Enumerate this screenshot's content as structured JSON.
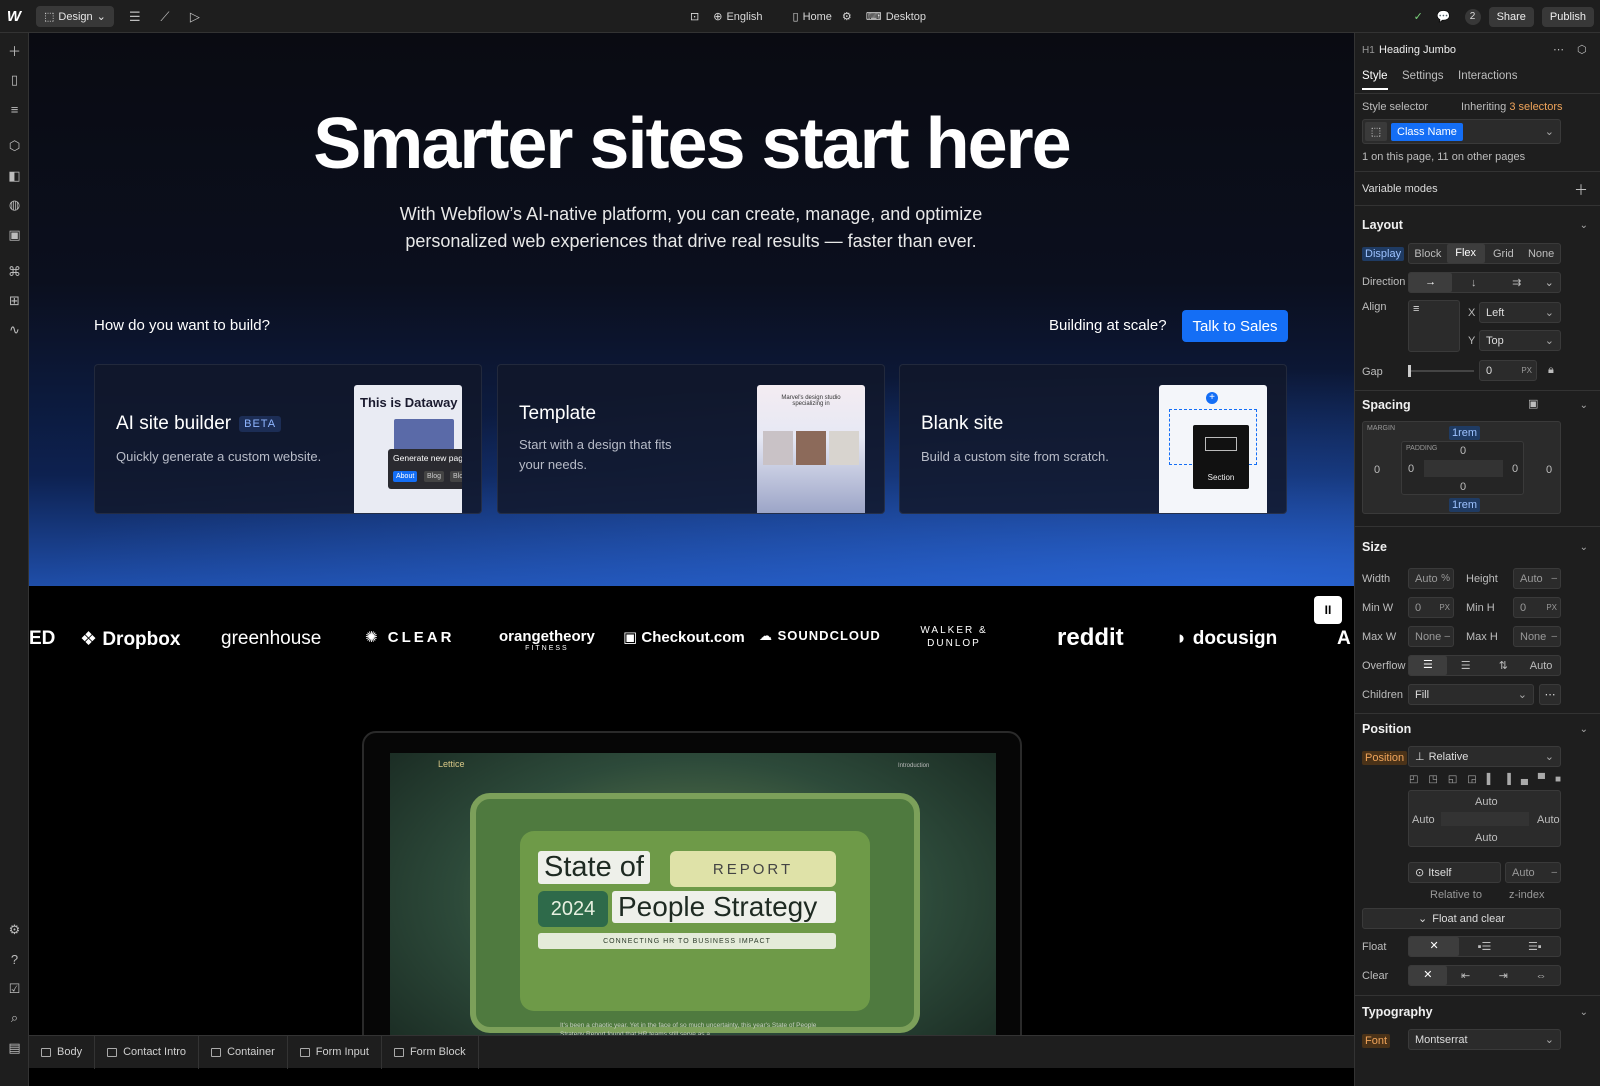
{
  "topbar": {
    "mode": "Design",
    "language": "English",
    "page": "Home",
    "breakpoint": "Desktop",
    "collab_count": "2",
    "share": "Share",
    "publish": "Publish"
  },
  "hero": {
    "title": "Smarter sites start here",
    "subtitle_line1": "With Webflow’s AI-native platform, you can create, manage, and optimize",
    "subtitle_line2": "personalized web experiences that drive real results — faster than ever.",
    "build_question": "How do you want to build?",
    "scale_question": "Building at scale?",
    "cta": "Talk to Sales"
  },
  "cards": [
    {
      "title": "AI site builder",
      "badge": "BETA",
      "desc": "Quickly generate a custom website.",
      "thumb_title": "This is Dataway",
      "thumb_popup": "Generate new page",
      "thumb_chips": [
        "About",
        "Blog",
        "Blog Post"
      ]
    },
    {
      "title": "Template",
      "desc_line1": "Start with a design that fits",
      "desc_line2": "your needs.",
      "thumb_title": "Marvel's design studio specializing in"
    },
    {
      "title": "Blank site",
      "desc": "Build a custom site from scratch.",
      "thumb_label": "Section"
    }
  ],
  "logos": [
    "ED",
    "Dropbox",
    "greenhouse",
    "CLEAR",
    "orangetheory",
    "Checkout.com",
    "SOUNDCLOUD",
    "WALKER & DUNLOP",
    "reddit",
    "docusign",
    "A"
  ],
  "logos_sub": {
    "orangetheory": "FITNESS"
  },
  "device": {
    "brand": "Lettice",
    "nav": "Introduction",
    "report_l1": "State of",
    "report_badge": "REPORT",
    "report_year": "2024",
    "report_l2": "People Strategy",
    "report_tag": "CONNECTING HR TO BUSINESS IMPACT",
    "caption": "It's been a chaotic year. Yet in the face of so much uncertainty, this year's State of People Strategy Report found that HR teams still serve as a"
  },
  "breadcrumbs": [
    "Body",
    "Contact Intro",
    "Container",
    "Form Input",
    "Form Block"
  ],
  "panel": {
    "element_tag": "H1",
    "element_name": "Heading Jumbo",
    "tabs": [
      "Style",
      "Settings",
      "Interactions"
    ],
    "selector_label": "Style selector",
    "inheriting": "Inheriting",
    "inheriting_count": "3 selectors",
    "class_name": "Class Name",
    "usage": "1 on this page, 11 on other pages",
    "variable_modes": "Variable modes",
    "layout": {
      "title": "Layout",
      "display_label": "Display",
      "display_opts": [
        "Block",
        "Flex",
        "Grid",
        "None"
      ],
      "direction_label": "Direction",
      "align_label": "Align",
      "x_label": "X",
      "x_val": "Left",
      "y_label": "Y",
      "y_val": "Top",
      "gap_label": "Gap",
      "gap_val": "0",
      "gap_unit": "PX"
    },
    "spacing": {
      "title": "Spacing",
      "margin_label": "MARGIN",
      "padding_label": "PADDING",
      "margin_top": "1rem",
      "margin_bottom": "1rem",
      "margin_left": "0",
      "margin_right": "0",
      "pad_top": "0",
      "pad_bottom": "0",
      "pad_left": "0",
      "pad_right": "0"
    },
    "size": {
      "title": "Size",
      "width_label": "Width",
      "width_val": "Auto",
      "width_unit": "%",
      "height_label": "Height",
      "height_val": "Auto",
      "height_unit": "–",
      "minw_label": "Min W",
      "minw_val": "0",
      "minw_unit": "PX",
      "minh_label": "Min H",
      "minh_val": "0",
      "minh_unit": "PX",
      "maxw_label": "Max W",
      "maxw_val": "None",
      "maxh_label": "Max H",
      "maxh_val": "None",
      "dash": "–",
      "overflow_label": "Overflow",
      "overflow_auto": "Auto",
      "children_label": "Children",
      "children_val": "Fill"
    },
    "position": {
      "title": "Position",
      "label": "Position",
      "val": "Relative",
      "top": "Auto",
      "left": "Auto",
      "right": "Auto",
      "bottom": "Auto",
      "rel_val": "Itself",
      "z_val": "Auto",
      "rel_label": "Relative to",
      "z_label": "z-index",
      "float_clear": "Float and clear",
      "float_label": "Float",
      "clear_label": "Clear"
    },
    "typography": {
      "title": "Typography",
      "font_label": "Font",
      "font_val": "Montserrat"
    }
  }
}
